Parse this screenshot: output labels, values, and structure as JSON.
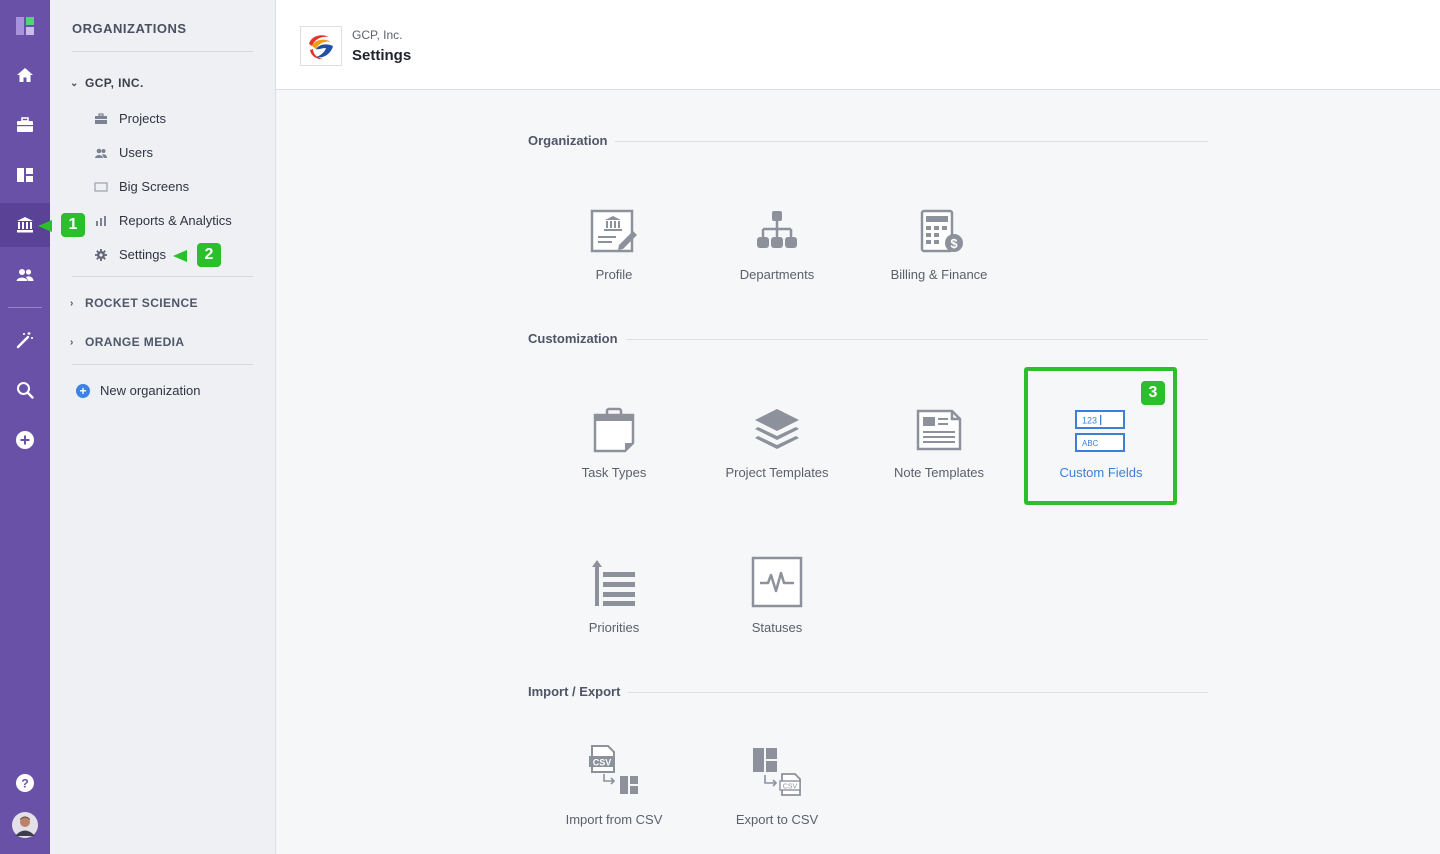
{
  "rail": {
    "items": [
      {
        "icon": "app-logo-icon"
      },
      {
        "icon": "home-icon"
      },
      {
        "icon": "briefcase-icon"
      },
      {
        "icon": "dashboard-icon"
      },
      {
        "icon": "organizations-bank-icon",
        "active": true
      },
      {
        "icon": "people-icon"
      },
      {
        "icon": "magic-wand-icon"
      },
      {
        "icon": "search-icon"
      },
      {
        "icon": "add-circle-icon"
      },
      {
        "icon": "help-icon"
      },
      {
        "icon": "avatar"
      }
    ],
    "accent": "#6a51a8"
  },
  "orgbar": {
    "title": "ORGANIZATIONS",
    "groups": [
      {
        "name": "GCP, INC.",
        "expanded": true,
        "items": [
          {
            "label": "Projects",
            "icon": "briefcase-icon"
          },
          {
            "label": "Users",
            "icon": "users-icon"
          },
          {
            "label": "Big Screens",
            "icon": "screen-icon"
          },
          {
            "label": "Reports & Analytics",
            "icon": "bar-chart-icon"
          },
          {
            "label": "Settings",
            "icon": "gear-icon"
          }
        ]
      },
      {
        "name": "ROCKET SCIENCE",
        "expanded": false
      },
      {
        "name": "ORANGE MEDIA",
        "expanded": false
      }
    ],
    "new_org": "New organization"
  },
  "callouts": {
    "one": "1",
    "two": "2",
    "three": "3",
    "color": "#2cbf2c"
  },
  "header": {
    "crumb": "GCP, Inc.",
    "title": "Settings"
  },
  "sections": [
    {
      "label": "Organization",
      "tiles": [
        {
          "label": "Profile",
          "icon": "profile-icon"
        },
        {
          "label": "Departments",
          "icon": "departments-icon"
        },
        {
          "label": "Billing & Finance",
          "icon": "billing-icon"
        }
      ]
    },
    {
      "label": "Customization",
      "tiles": [
        {
          "label": "Task Types",
          "icon": "task-types-icon"
        },
        {
          "label": "Project Templates",
          "icon": "layers-icon"
        },
        {
          "label": "Note Templates",
          "icon": "note-icon"
        },
        {
          "label": "Custom Fields",
          "icon": "custom-fields-icon",
          "selected": true
        },
        {
          "label": "Priorities",
          "icon": "priorities-icon"
        },
        {
          "label": "Statuses",
          "icon": "statuses-icon"
        }
      ]
    },
    {
      "label": "Import / Export",
      "tiles": [
        {
          "label": "Import from CSV",
          "icon": "import-csv-icon"
        },
        {
          "label": "Export to CSV",
          "icon": "export-csv-icon"
        }
      ]
    }
  ],
  "custom_fields_icon_text": {
    "top": "123",
    "bottom": "ABC"
  },
  "csv_text": "CSV"
}
